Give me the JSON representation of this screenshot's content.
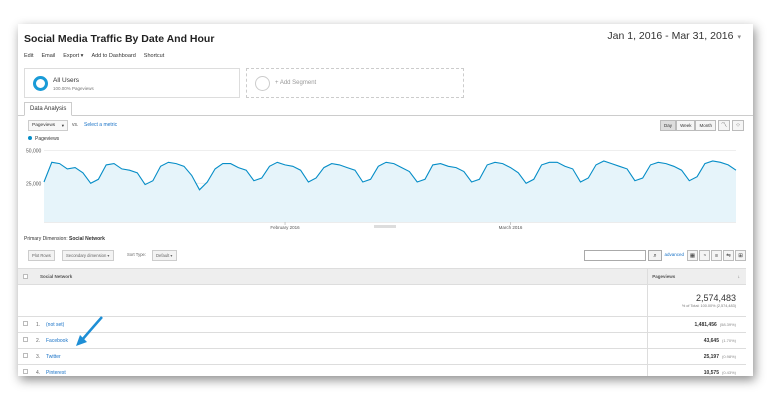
{
  "title": "Social Media Traffic By Date And Hour",
  "date_range": "Jan 1, 2016 - Mar 31, 2016",
  "toolbar": [
    "Edit",
    "Email",
    "Export ▾",
    "Add to Dashboard",
    "Shortcut"
  ],
  "segments": {
    "active_name": "All Users",
    "active_sub": "100.00% Pageviews",
    "add_label": "+ Add Segment"
  },
  "tabs": {
    "data_analysis": "Data Analysis"
  },
  "chart_controls": {
    "metric": "Pageviews",
    "vs": "vs.",
    "select_metric": "Select a metric",
    "granularity": [
      "Day",
      "Week",
      "Month"
    ],
    "active_granularity": "Day"
  },
  "chart_data": {
    "type": "line",
    "series": [
      {
        "name": "Pageviews",
        "color": "#058dc7"
      }
    ],
    "y_ticks": [
      "50,000",
      "25,000"
    ],
    "x_ticks": [
      "February 2016",
      "March 2016"
    ],
    "ylim": [
      0,
      55000
    ],
    "values": [
      26000,
      41000,
      40000,
      36000,
      37000,
      33000,
      25000,
      28000,
      39000,
      40000,
      36000,
      35000,
      33000,
      24000,
      27000,
      38000,
      41000,
      40000,
      38000,
      31000,
      20000,
      26000,
      36000,
      40000,
      40000,
      37000,
      35000,
      27000,
      29000,
      38000,
      41000,
      39000,
      38000,
      35000,
      26000,
      29000,
      37000,
      40000,
      39000,
      37000,
      35000,
      26000,
      28000,
      38000,
      41000,
      40000,
      37000,
      34000,
      26000,
      28000,
      39000,
      40000,
      38000,
      37000,
      34000,
      26000,
      28000,
      39000,
      41000,
      40000,
      37000,
      33000,
      25000,
      28000,
      39000,
      41000,
      41000,
      38000,
      36000,
      26000,
      29000,
      39000,
      42000,
      40000,
      38000,
      36000,
      27000,
      29000,
      39000,
      41000,
      40000,
      38000,
      35000,
      27000,
      30000,
      40000,
      42000,
      41000,
      39000,
      35000
    ]
  },
  "primary_dimension": {
    "label": "Primary Dimension:",
    "value": "Social Network"
  },
  "filter_row": {
    "plot_rows": "Plot Rows",
    "secondary": "Secondary dimension ▾",
    "sort_type_label": "Sort Type:",
    "sort_type": "Default ▾",
    "advanced": "advanced"
  },
  "table": {
    "headers": {
      "dimension": "Social Network",
      "metric": "Pageviews"
    },
    "total": {
      "value": "2,574,483",
      "sub": "% of Total: 100.00% (2,574,483)"
    },
    "rows": [
      {
        "index": "1.",
        "name": "(not set)",
        "value": "1,481,456",
        "pct": "(58.39%)"
      },
      {
        "index": "2.",
        "name": "Facebook",
        "value": "43,645",
        "pct": "(1.70%)"
      },
      {
        "index": "3.",
        "name": "Twitter",
        "value": "25,197",
        "pct": "(0.98%)"
      },
      {
        "index": "4.",
        "name": "Pinterest",
        "value": "10,575",
        "pct": "(0.43%)"
      }
    ]
  },
  "annotation_arrow_color": "#1e8fd6"
}
